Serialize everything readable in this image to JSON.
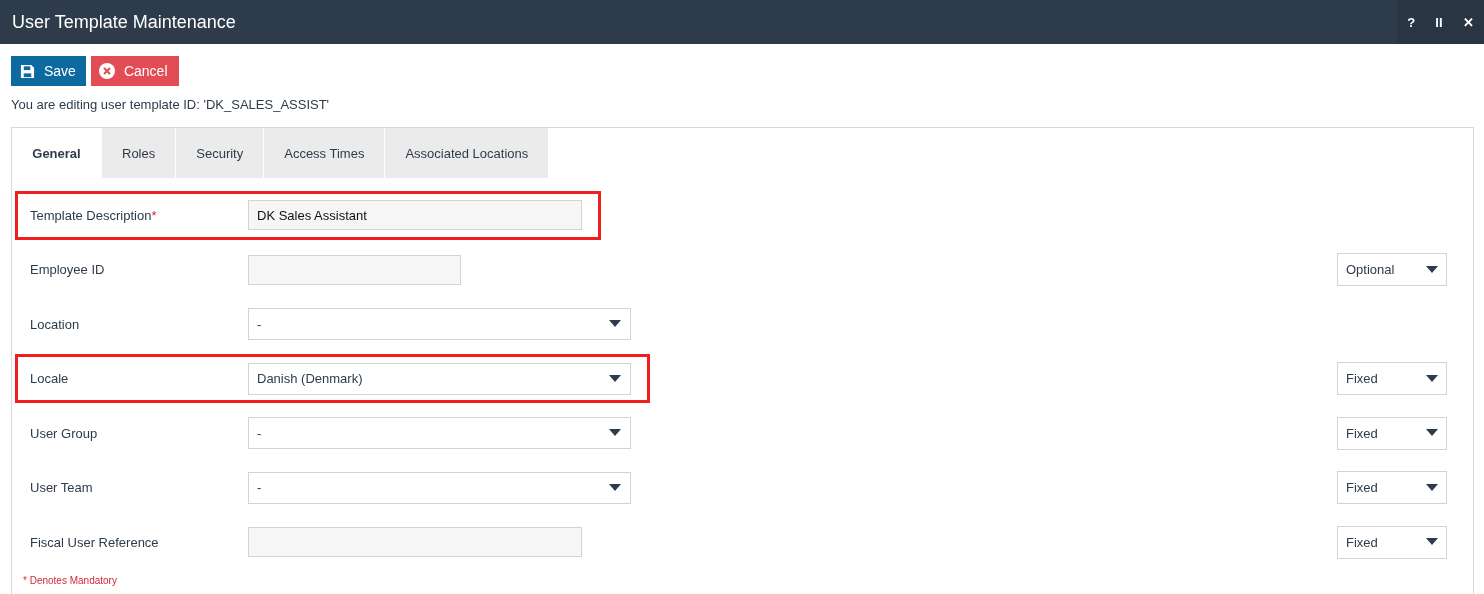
{
  "window": {
    "title": "User Template Maintenance",
    "controls": [
      "?",
      "II",
      "✕"
    ]
  },
  "toolbar": [
    {
      "kind": "save",
      "label": "Save"
    },
    {
      "kind": "cancel",
      "label": "Cancel"
    }
  ],
  "info": "You are editing user template ID: 'DK_SALES_ASSIST'",
  "tabs": [
    {
      "label": "General",
      "selected": true
    },
    {
      "label": "Roles",
      "selected": false
    },
    {
      "label": "Security",
      "selected": false
    },
    {
      "label": "Access Times",
      "selected": false
    },
    {
      "label": "Associated Locations",
      "selected": false
    }
  ],
  "fields": [
    {
      "label": "Template Description",
      "required_marker": "*",
      "kind": "text",
      "value": "DK Sales Assistant",
      "highlighted": true
    },
    {
      "label": "Employee ID",
      "kind": "short",
      "highlighted": false,
      "mode": "Optional"
    },
    {
      "label": "Location",
      "kind": "select",
      "value": "-",
      "highlighted": false
    },
    {
      "label": "Locale",
      "kind": "select",
      "value": "Danish (Denmark)",
      "highlighted": true,
      "mode": "Fixed"
    },
    {
      "label": "User Group",
      "kind": "select",
      "value": "-",
      "highlighted": false,
      "mode": "Fixed"
    },
    {
      "label": "User Team",
      "kind": "select",
      "value": "-",
      "highlighted": false,
      "mode": "Fixed"
    },
    {
      "label": "Fiscal User Reference",
      "kind": "text",
      "highlighted": false,
      "mode": "Fixed"
    }
  ],
  "mandatory_note": "* Denotes Mandatory"
}
